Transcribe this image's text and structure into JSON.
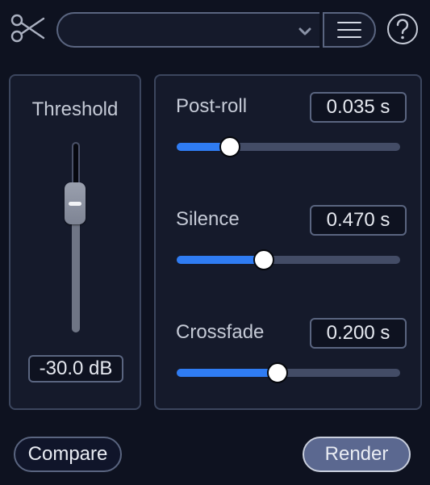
{
  "header": {
    "tool_icon": "scissors-icon",
    "preset_value": "",
    "preset_dropdown_icon": "chevron-down-icon",
    "menu_icon": "hamburger-menu-icon",
    "help_icon": "question-mark-icon"
  },
  "threshold": {
    "label": "Threshold",
    "value_text": "-30.0 dB",
    "level_fraction": 0.31
  },
  "params": [
    {
      "label": "Post-roll",
      "value_text": "0.035 s",
      "fraction": 0.24
    },
    {
      "label": "Silence",
      "value_text": "0.470 s",
      "fraction": 0.39
    },
    {
      "label": "Crossfade",
      "value_text": "0.200 s",
      "fraction": 0.45
    }
  ],
  "footer": {
    "compare_label": "Compare",
    "render_label": "Render"
  },
  "colors": {
    "background": "#0e1220",
    "accent": "#2f7cf3",
    "render_button": "#5b6890"
  }
}
